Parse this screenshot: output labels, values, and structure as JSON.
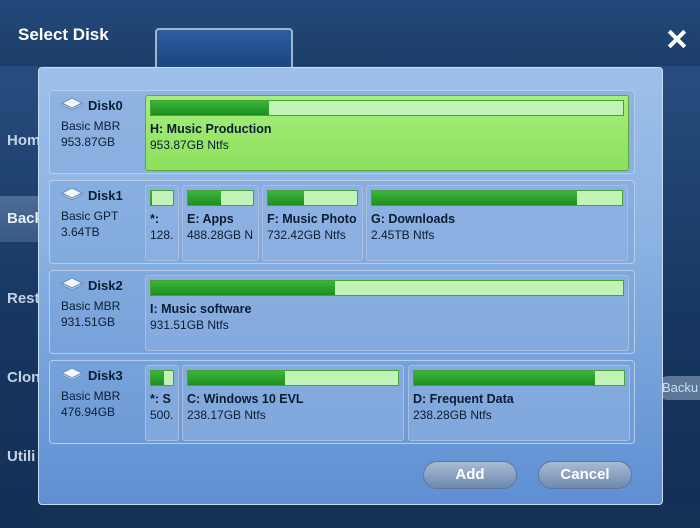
{
  "background": {
    "nav": [
      "Hom",
      "Back",
      "Rest",
      "Clon",
      "Utili"
    ],
    "side_button": "Backu"
  },
  "dialog": {
    "title": "Select Disk",
    "add_label": "Add",
    "cancel_label": "Cancel"
  },
  "disks": [
    {
      "name": "Disk0",
      "type": "Basic MBR",
      "size": "953.87GB",
      "partitions": [
        {
          "label": "H: Music Production",
          "size": "953.87GB Ntfs",
          "used": 0.25,
          "selected": true
        }
      ]
    },
    {
      "name": "Disk1",
      "type": "Basic GPT",
      "size": "3.64TB",
      "partitions": [
        {
          "label": "*:",
          "size": "128.",
          "used": 0.05
        },
        {
          "label": "E: Apps",
          "size": "488.28GB N",
          "used": 0.5
        },
        {
          "label": "F: Music Photo",
          "size": "732.42GB Ntfs",
          "used": 0.4
        },
        {
          "label": "G: Downloads",
          "size": "2.45TB Ntfs",
          "used": 0.82
        }
      ]
    },
    {
      "name": "Disk2",
      "type": "Basic MBR",
      "size": "931.51GB",
      "partitions": [
        {
          "label": "I: Music software",
          "size": "931.51GB Ntfs",
          "used": 0.39
        }
      ]
    },
    {
      "name": "Disk3",
      "type": "Basic MBR",
      "size": "476.94GB",
      "partitions": [
        {
          "label": "*: S",
          "size": "500.",
          "used": 0.6
        },
        {
          "label": "C: Windows 10 EVL",
          "size": "238.17GB Ntfs",
          "used": 0.46
        },
        {
          "label": "D: Frequent Data",
          "size": "238.28GB Ntfs",
          "used": 0.86
        }
      ]
    }
  ]
}
